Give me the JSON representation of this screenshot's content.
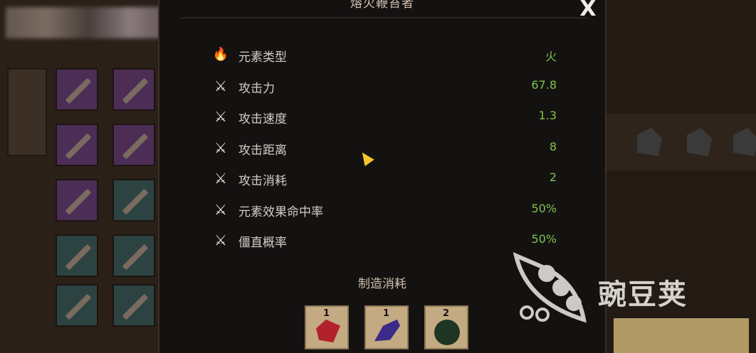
{
  "panel": {
    "title": "熔火鞭笞者",
    "close_label": "X"
  },
  "stats": [
    {
      "label": "元素类型",
      "value": "火",
      "icon": "fire-icon"
    },
    {
      "label": "攻击力",
      "value": "67.8",
      "icon": "crossed-swords-icon"
    },
    {
      "label": "攻击速度",
      "value": "1.3",
      "icon": "sword-speed-icon"
    },
    {
      "label": "攻击距离",
      "value": "8",
      "icon": "sword-range-icon"
    },
    {
      "label": "攻击消耗",
      "value": "2",
      "icon": "sword-cost-icon"
    },
    {
      "label": "元素效果命中率",
      "value": "50%",
      "icon": "sword-element-icon"
    },
    {
      "label": "僵直概率",
      "value": "50%",
      "icon": "sword-stun-icon"
    }
  ],
  "crafting": {
    "title": "制造消耗",
    "materials": [
      {
        "count": "1",
        "icon": "red-crystal-icon"
      },
      {
        "count": "1",
        "icon": "purple-feather-icon"
      },
      {
        "count": "2",
        "icon": "green-ore-icon"
      }
    ]
  },
  "watermark": {
    "text": "豌豆荚"
  },
  "colors": {
    "stat_value": "#7fc34c",
    "label": "#d4cdc4",
    "panel_bg": "#141211"
  }
}
